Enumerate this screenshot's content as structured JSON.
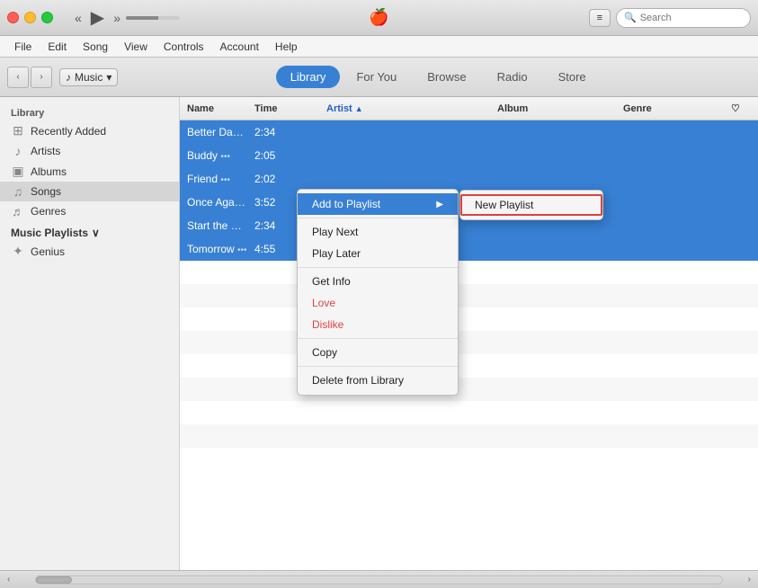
{
  "titleBar": {
    "trafficLights": [
      "close",
      "minimize",
      "maximize"
    ],
    "appleLogo": "🍎",
    "listBtn": "≡",
    "search": {
      "placeholder": "Search",
      "value": ""
    }
  },
  "transport": {
    "rewind": "«",
    "play": "▶",
    "fastForward": "»"
  },
  "menuBar": {
    "items": [
      "File",
      "Edit",
      "Song",
      "View",
      "Controls",
      "Account",
      "Help"
    ]
  },
  "navBar": {
    "back": "‹",
    "forward": "›",
    "musicLabel": "Music",
    "tabs": [
      {
        "id": "library",
        "label": "Library",
        "active": true
      },
      {
        "id": "for-you",
        "label": "For You",
        "active": false
      },
      {
        "id": "browse",
        "label": "Browse",
        "active": false
      },
      {
        "id": "radio",
        "label": "Radio",
        "active": false
      },
      {
        "id": "store",
        "label": "Store",
        "active": false
      }
    ]
  },
  "sidebar": {
    "libraryLabel": "Library",
    "items": [
      {
        "id": "recently-added",
        "icon": "⊞",
        "label": "Recently Added"
      },
      {
        "id": "artists",
        "icon": "♪",
        "label": "Artists"
      },
      {
        "id": "albums",
        "icon": "▣",
        "label": "Albums"
      },
      {
        "id": "songs",
        "icon": "♫",
        "label": "Songs",
        "active": true
      },
      {
        "id": "genres",
        "icon": "♬",
        "label": "Genres"
      }
    ],
    "playlistsLabel": "Music Playlists",
    "playlistsArrow": "∨",
    "playlistItems": [
      {
        "id": "genius",
        "icon": "✦",
        "label": "Genius"
      }
    ]
  },
  "table": {
    "columns": [
      {
        "id": "name",
        "label": "Name"
      },
      {
        "id": "time",
        "label": "Time"
      },
      {
        "id": "artist",
        "label": "Artist",
        "sortActive": true,
        "sortDir": "▲"
      },
      {
        "id": "spacer",
        "label": ""
      },
      {
        "id": "album",
        "label": "Album"
      },
      {
        "id": "genre",
        "label": "Genre"
      },
      {
        "id": "love",
        "label": "♡"
      }
    ],
    "rows": [
      {
        "id": 1,
        "name": "Better Days",
        "dots": "•••",
        "time": "2:34",
        "artist": "",
        "album": "",
        "genre": "",
        "selected": true
      },
      {
        "id": 2,
        "name": "Buddy",
        "dots": "•••",
        "time": "2:05",
        "artist": "",
        "album": "",
        "genre": "",
        "selected": true
      },
      {
        "id": 3,
        "name": "Friend",
        "dots": "•••",
        "time": "2:02",
        "artist": "",
        "album": "",
        "genre": "",
        "selected": true
      },
      {
        "id": 4,
        "name": "Once Again",
        "dots": "•••",
        "time": "3:52",
        "artist": "",
        "album": "",
        "genre": "",
        "selected": true
      },
      {
        "id": 5,
        "name": "Start the Day",
        "dots": "•••",
        "time": "2:34",
        "artist": "",
        "album": "",
        "genre": "",
        "selected": true
      },
      {
        "id": 6,
        "name": "Tomorrow",
        "dots": "•••",
        "time": "4:55",
        "artist": "",
        "album": "",
        "genre": "",
        "selected": true
      },
      {
        "id": 7,
        "name": "",
        "dots": "",
        "time": "",
        "selected": false
      },
      {
        "id": 8,
        "name": "",
        "dots": "",
        "time": "",
        "selected": false
      },
      {
        "id": 9,
        "name": "",
        "dots": "",
        "time": "",
        "selected": false
      },
      {
        "id": 10,
        "name": "",
        "dots": "",
        "time": "",
        "selected": false
      },
      {
        "id": 11,
        "name": "",
        "dots": "",
        "time": "",
        "selected": false
      },
      {
        "id": 12,
        "name": "",
        "dots": "",
        "time": "",
        "selected": false
      },
      {
        "id": 13,
        "name": "",
        "dots": "",
        "time": "",
        "selected": false
      },
      {
        "id": 14,
        "name": "",
        "dots": "",
        "time": "",
        "selected": false
      },
      {
        "id": 15,
        "name": "",
        "dots": "",
        "time": "",
        "selected": false
      }
    ]
  },
  "contextMenu": {
    "items": [
      {
        "id": "add-to-playlist",
        "label": "Add to Playlist",
        "hasArrow": true,
        "highlighted": true
      },
      {
        "id": "separator1",
        "type": "separator"
      },
      {
        "id": "play-next",
        "label": "Play Next"
      },
      {
        "id": "play-later",
        "label": "Play Later"
      },
      {
        "id": "separator2",
        "type": "separator"
      },
      {
        "id": "get-info",
        "label": "Get Info"
      },
      {
        "id": "love",
        "label": "Love"
      },
      {
        "id": "dislike",
        "label": "Dislike"
      },
      {
        "id": "separator3",
        "type": "separator"
      },
      {
        "id": "copy",
        "label": "Copy"
      },
      {
        "id": "separator4",
        "type": "separator"
      },
      {
        "id": "delete",
        "label": "Delete from Library"
      }
    ],
    "submenu": {
      "items": [
        {
          "id": "new-playlist",
          "label": "New Playlist",
          "highlighted": true
        }
      ]
    }
  },
  "statusBar": {
    "scrollLeft": "‹",
    "scrollRight": "›"
  }
}
